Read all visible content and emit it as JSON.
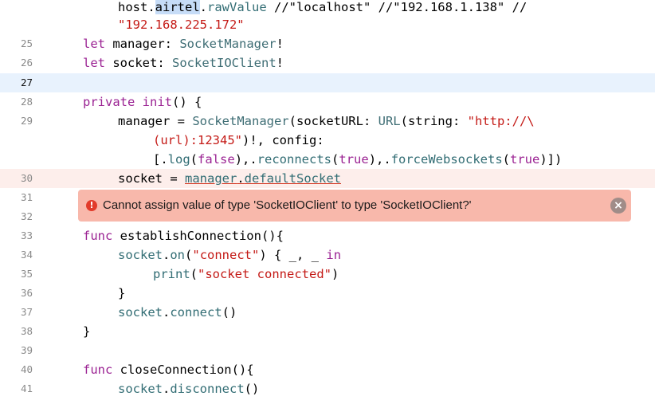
{
  "editor": {
    "line_numbers": {
      "l25": "25",
      "l26": "26",
      "l27": "27",
      "l28": "28",
      "l29": "29",
      "l30": "30",
      "l31": "31",
      "l32": "32",
      "l33": "33",
      "l34": "34",
      "l35": "35",
      "l36": "36",
      "l37": "37",
      "l38": "38",
      "l39": "39",
      "l40": "40",
      "l41": "41"
    },
    "tokens": {
      "t1_a": "host.",
      "t1_b": "airtel",
      "t1_c": ".",
      "t1_d": "rawValue",
      "t1_e": " //\"localhost\" //\"192.168.1.138\" //",
      "t2_a": "\"192.168.225.172\"",
      "t25_kw": "let",
      "t25_a": " manager: ",
      "t25_ty": "SocketManager",
      "t25_b": "!",
      "t26_kw": "let",
      "t26_a": " socket: ",
      "t26_ty": "SocketIOClient",
      "t26_b": "!",
      "t28_kw1": "private",
      "t28_kw2": "init",
      "t28_a": "() {",
      "t29_a": "manager = ",
      "t29_ty1": "SocketManager",
      "t29_b": "(socketURL: ",
      "t29_ty2": "URL",
      "t29_c": "(string: ",
      "t29_str": "\"http://\\",
      "t29w1_str1": "(url)",
      "t29w1_str2": ":12345\"",
      "t29w1_a": ")!, config:",
      "t29w2_a": "[.",
      "t29w2_p1": "log",
      "t29w2_b": "(",
      "t29w2_kw1": "false",
      "t29w2_c": "),.",
      "t29w2_p2": "reconnects",
      "t29w2_d": "(",
      "t29w2_kw2": "true",
      "t29w2_e": "),.",
      "t29w2_p3": "forceWebsockets",
      "t29w2_f": "(",
      "t29w2_kw3": "true",
      "t29w2_g": ")])",
      "t30_a": "socket = ",
      "t30_b": "manager",
      "t30_c": ".",
      "t30_d": "defaultSocket",
      "t33_kw": "func",
      "t33_a": " establishConnection(){",
      "t34_p": "socket",
      "t34_a": ".",
      "t34_p2": "on",
      "t34_b": "(",
      "t34_str": "\"connect\"",
      "t34_c": ") { _, _ ",
      "t34_kw": "in",
      "t35_p": "print",
      "t35_a": "(",
      "t35_str": "\"socket connected\"",
      "t35_b": ")",
      "t36_a": "}",
      "t37_p": "socket",
      "t37_a": ".",
      "t37_p2": "connect",
      "t37_b": "()",
      "t38_a": "}",
      "t40_kw": "func",
      "t40_a": " closeConnection(){",
      "t41_p": "socket",
      "t41_a": ".",
      "t41_p2": "disconnect",
      "t41_b": "()"
    }
  },
  "error": {
    "icon": "error-icon",
    "icon_glyph": "!",
    "message": "Cannot assign value of type 'SocketIOClient' to type 'SocketIOClient?'",
    "close_glyph": "×"
  },
  "colors": {
    "keyword": "#9b2393",
    "type": "#3e6d74",
    "string": "#c41a16",
    "error_banner": "#f8b8ab",
    "current_line": "#e8f2fd"
  }
}
